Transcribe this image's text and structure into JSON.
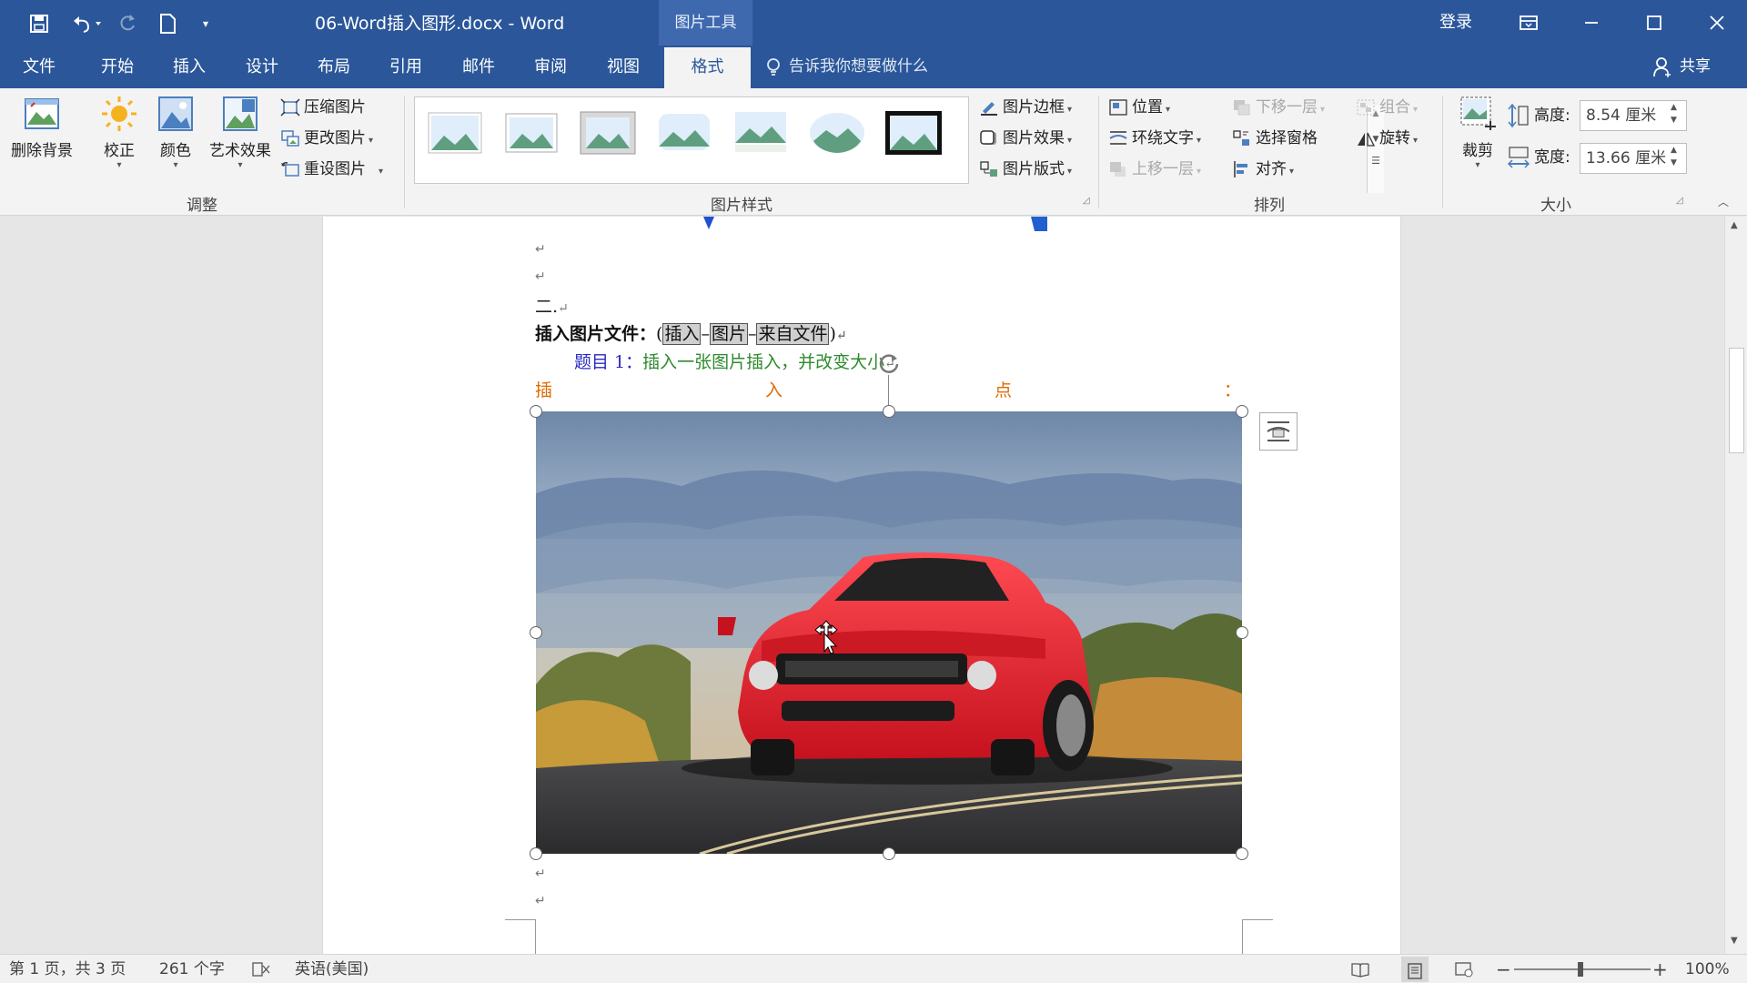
{
  "titlebar": {
    "doc_title": "06-Word插入图形.docx  -  Word",
    "context_tab": "图片工具",
    "login": "登录"
  },
  "tabs": [
    "文件",
    "开始",
    "插入",
    "设计",
    "布局",
    "引用",
    "邮件",
    "审阅",
    "视图",
    "格式"
  ],
  "active_tab": "格式",
  "tellme": "告诉我你想要做什么",
  "share": "共享",
  "ribbon": {
    "adjust": {
      "remove_bg": "删除背景",
      "correct": "校正",
      "color": "颜色",
      "art_effects": "艺术效果",
      "compress": "压缩图片",
      "change": "更改图片",
      "reset": "重设图片",
      "label": "调整"
    },
    "styles": {
      "border": "图片边框",
      "effects": "图片效果",
      "layout": "图片版式",
      "label": "图片样式"
    },
    "arrange": {
      "position": "位置",
      "wrap": "环绕文字",
      "forward": "上移一层",
      "backward": "下移一层",
      "pane": "选择窗格",
      "align": "对齐",
      "group": "组合",
      "rotate": "旋转",
      "label": "排列"
    },
    "size": {
      "crop": "裁剪",
      "height_label": "高度:",
      "height_value": "8.54 厘米",
      "width_label": "宽度:",
      "width_value": "13.66 厘米",
      "label": "大小"
    }
  },
  "document": {
    "line_er": "二.",
    "insert_label": "插入图片文件：",
    "insert_p1": "插入",
    "insert_p2": "图片",
    "insert_p3": "来自文件",
    "topic_label": "题目 1：",
    "topic_text": "插入一张图片插入，并改变大小",
    "orange_1": "插",
    "orange_2": "入",
    "orange_3": "点",
    "orange_4": "："
  },
  "statusbar": {
    "page": "第 1 页，共 3 页",
    "words": "261 个字",
    "lang": "英语(美国)",
    "zoom": "100%"
  },
  "colors": {
    "brand": "#2b579a",
    "ribbon": "#f3f3f3",
    "topic_blue": "#2a2ac4",
    "topic_green": "#2e8b2e",
    "orange": "#e06b00"
  }
}
